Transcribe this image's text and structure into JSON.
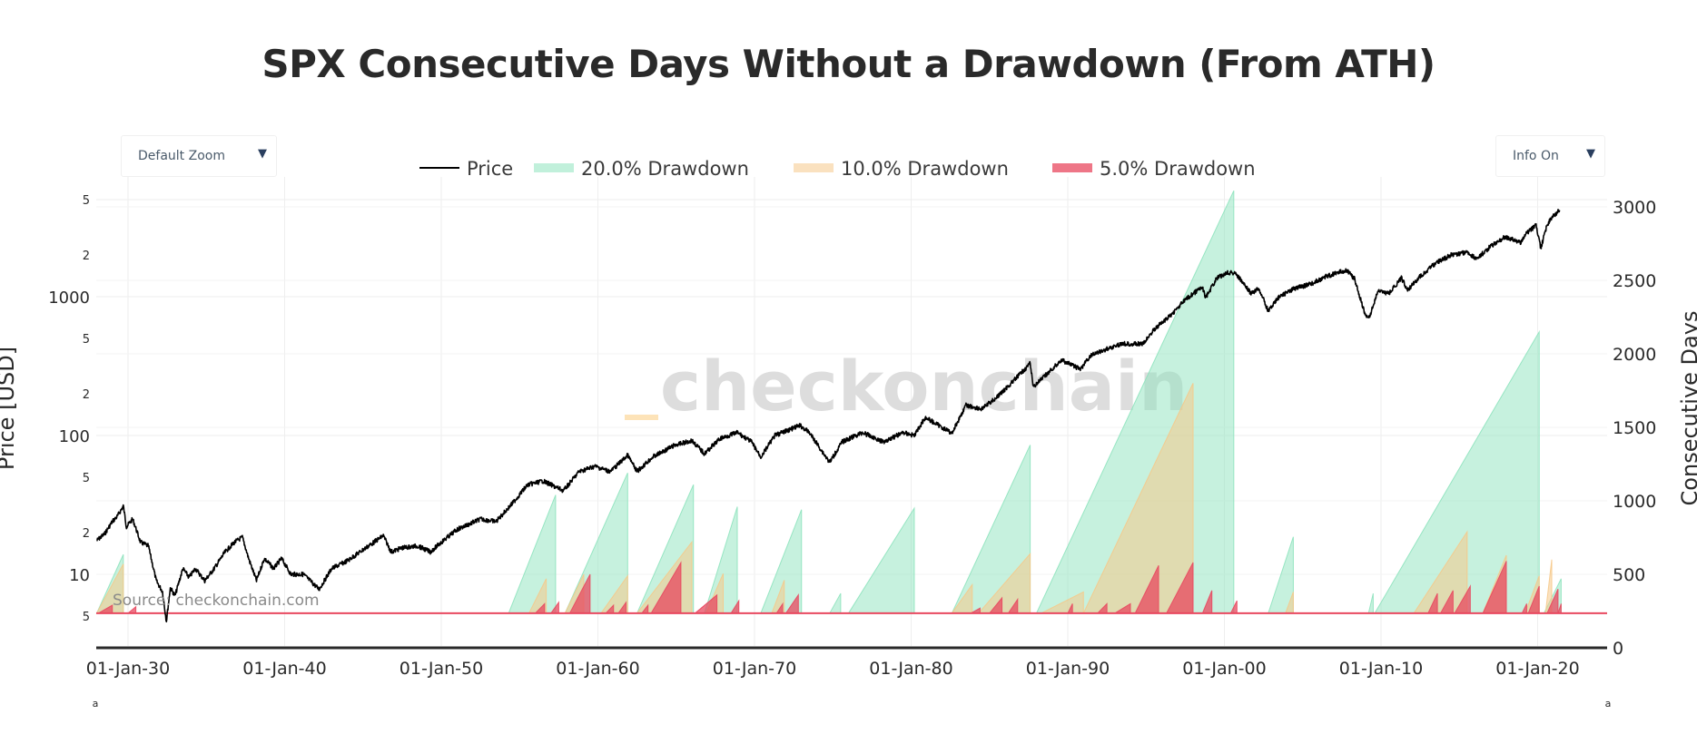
{
  "header": {
    "title": "SPX Consecutive Days Without a Drawdown (From ATH)"
  },
  "controls": {
    "zoom_dropdown": {
      "label": "Default Zoom",
      "icon": "triangle-down-icon"
    },
    "info_dropdown": {
      "label": "Info On",
      "icon": "triangle-down-icon"
    }
  },
  "watermark": "checkonchain",
  "source": "Source: checkonchain.com",
  "colors": {
    "price": "#000000",
    "dd20": "#8ee3be",
    "dd10": "#f6c98a",
    "dd5": "#e8485f",
    "grid": "#eeeeee",
    "axis": "#2a2a2a"
  },
  "chart_data": {
    "type": "area",
    "title": "SPX Consecutive Days Without a Drawdown (From ATH)",
    "xlabel": "",
    "ylabel": "Price [USD]",
    "y2label": "Consecutive Days",
    "x_range": [
      1928.0,
      2021.5
    ],
    "x_ticks": [
      {
        "year": 1930,
        "label": "01-Jan-30"
      },
      {
        "year": 1940,
        "label": "01-Jan-40"
      },
      {
        "year": 1950,
        "label": "01-Jan-50"
      },
      {
        "year": 1960,
        "label": "01-Jan-60"
      },
      {
        "year": 1970,
        "label": "01-Jan-70"
      },
      {
        "year": 1980,
        "label": "01-Jan-80"
      },
      {
        "year": 1990,
        "label": "01-Jan-90"
      },
      {
        "year": 2000,
        "label": "01-Jan-00"
      },
      {
        "year": 2010,
        "label": "01-Jan-10"
      },
      {
        "year": 2020,
        "label": "01-Jan-20"
      }
    ],
    "x_minor_labels": [
      "a",
      "a"
    ],
    "y_axis": {
      "scale": "log",
      "range": [
        4.4,
        6000
      ],
      "ticks": [
        {
          "value": 5,
          "label": "5"
        },
        {
          "value": 10,
          "label": "10"
        },
        {
          "value": 20,
          "label": "2"
        },
        {
          "value": 50,
          "label": "5"
        },
        {
          "value": 100,
          "label": "100"
        },
        {
          "value": 200,
          "label": "2"
        },
        {
          "value": 500,
          "label": "5"
        },
        {
          "value": 1000,
          "label": "1000"
        },
        {
          "value": 2000,
          "label": "2"
        },
        {
          "value": 5000,
          "label": "5"
        }
      ]
    },
    "y2_axis": {
      "scale": "linear",
      "range": [
        0,
        3200
      ],
      "ticks": [
        {
          "value": 0,
          "label": "0"
        },
        {
          "value": 500,
          "label": "500"
        },
        {
          "value": 1000,
          "label": "1000"
        },
        {
          "value": 1500,
          "label": "1500"
        },
        {
          "value": 2000,
          "label": "2000"
        },
        {
          "value": 2500,
          "label": "2500"
        },
        {
          "value": 3000,
          "label": "3000"
        }
      ]
    },
    "grid": true,
    "legend": {
      "placement": "top-center",
      "entries": [
        {
          "key": "price",
          "label": "Price"
        },
        {
          "key": "dd20",
          "label": "20.0% Drawdown"
        },
        {
          "key": "dd10",
          "label": "10.0% Drawdown"
        },
        {
          "key": "dd5",
          "label": "5.0% Drawdown"
        }
      ]
    },
    "series": [
      {
        "name": "Price",
        "key": "price",
        "axis": "y",
        "type": "line",
        "points": [
          [
            1928.0,
            17.5
          ],
          [
            1928.5,
            19.5
          ],
          [
            1929.0,
            24
          ],
          [
            1929.3,
            26
          ],
          [
            1929.7,
            31
          ],
          [
            1929.9,
            22
          ],
          [
            1930.3,
            25
          ],
          [
            1930.8,
            17
          ],
          [
            1931.3,
            16
          ],
          [
            1931.8,
            9
          ],
          [
            1932.2,
            7.5
          ],
          [
            1932.45,
            4.6
          ],
          [
            1932.7,
            8
          ],
          [
            1933.0,
            7
          ],
          [
            1933.5,
            11
          ],
          [
            1933.9,
            9.5
          ],
          [
            1934.3,
            11
          ],
          [
            1934.9,
            9
          ],
          [
            1935.5,
            11
          ],
          [
            1936.2,
            14.5
          ],
          [
            1936.8,
            17
          ],
          [
            1937.3,
            18.5
          ],
          [
            1937.7,
            13
          ],
          [
            1938.2,
            9
          ],
          [
            1938.7,
            13
          ],
          [
            1939.3,
            11
          ],
          [
            1939.8,
            13
          ],
          [
            1940.4,
            10
          ],
          [
            1941.2,
            10
          ],
          [
            1942.2,
            7.8
          ],
          [
            1943.0,
            11
          ],
          [
            1944.0,
            12.5
          ],
          [
            1945.0,
            15
          ],
          [
            1946.3,
            19
          ],
          [
            1946.8,
            14.5
          ],
          [
            1947.5,
            15.5
          ],
          [
            1948.5,
            16
          ],
          [
            1949.3,
            14.5
          ],
          [
            1950.0,
            17
          ],
          [
            1951.0,
            21
          ],
          [
            1952.5,
            25
          ],
          [
            1953.5,
            24
          ],
          [
            1954.5,
            32
          ],
          [
            1955.5,
            44
          ],
          [
            1956.5,
            47
          ],
          [
            1957.8,
            40
          ],
          [
            1958.8,
            55
          ],
          [
            1959.8,
            60
          ],
          [
            1960.8,
            55
          ],
          [
            1961.9,
            72
          ],
          [
            1962.5,
            55
          ],
          [
            1963.5,
            70
          ],
          [
            1964.9,
            85
          ],
          [
            1966.0,
            92
          ],
          [
            1966.8,
            74
          ],
          [
            1967.8,
            95
          ],
          [
            1968.9,
            105
          ],
          [
            1969.8,
            90
          ],
          [
            1970.4,
            70
          ],
          [
            1971.3,
            100
          ],
          [
            1972.9,
            118
          ],
          [
            1973.5,
            105
          ],
          [
            1974.8,
            64
          ],
          [
            1975.6,
            90
          ],
          [
            1976.9,
            105
          ],
          [
            1978.2,
            90
          ],
          [
            1979.5,
            105
          ],
          [
            1980.2,
            100
          ],
          [
            1980.9,
            135
          ],
          [
            1982.6,
            104
          ],
          [
            1983.5,
            165
          ],
          [
            1984.5,
            155
          ],
          [
            1985.5,
            190
          ],
          [
            1986.5,
            245
          ],
          [
            1987.6,
            330
          ],
          [
            1987.8,
            225
          ],
          [
            1988.5,
            265
          ],
          [
            1989.6,
            350
          ],
          [
            1990.8,
            300
          ],
          [
            1991.5,
            380
          ],
          [
            1992.5,
            420
          ],
          [
            1993.5,
            460
          ],
          [
            1994.8,
            455
          ],
          [
            1995.5,
            580
          ],
          [
            1996.5,
            720
          ],
          [
            1997.5,
            950
          ],
          [
            1998.6,
            1180
          ],
          [
            1998.8,
            980
          ],
          [
            1999.5,
            1350
          ],
          [
            2000.2,
            1500
          ],
          [
            2000.7,
            1480
          ],
          [
            2001.7,
            1050
          ],
          [
            2002.2,
            1150
          ],
          [
            2002.8,
            790
          ],
          [
            2003.5,
            1000
          ],
          [
            2004.5,
            1150
          ],
          [
            2005.5,
            1230
          ],
          [
            2006.5,
            1400
          ],
          [
            2007.8,
            1560
          ],
          [
            2008.3,
            1350
          ],
          [
            2008.9,
            800
          ],
          [
            2009.2,
            680
          ],
          [
            2009.8,
            1100
          ],
          [
            2010.5,
            1050
          ],
          [
            2011.3,
            1360
          ],
          [
            2011.7,
            1120
          ],
          [
            2012.5,
            1400
          ],
          [
            2013.5,
            1750
          ],
          [
            2014.5,
            2000
          ],
          [
            2015.5,
            2100
          ],
          [
            2016.1,
            1870
          ],
          [
            2016.9,
            2250
          ],
          [
            2017.9,
            2700
          ],
          [
            2018.9,
            2450
          ],
          [
            2019.2,
            2800
          ],
          [
            2019.9,
            3250
          ],
          [
            2020.2,
            2230
          ],
          [
            2020.6,
            3300
          ],
          [
            2021.0,
            3800
          ],
          [
            2021.4,
            4200
          ]
        ]
      },
      {
        "name": "20.0% Drawdown",
        "key": "dd20",
        "axis": "y2",
        "type": "sawtooth",
        "floor": 235,
        "runs": [
          [
            1928.0,
            1929.7,
            635
          ],
          [
            1954.3,
            1957.3,
            1040
          ],
          [
            1957.9,
            1961.9,
            1190
          ],
          [
            1962.5,
            1966.1,
            1110
          ],
          [
            1966.8,
            1968.9,
            960
          ],
          [
            1970.4,
            1973.0,
            940
          ],
          [
            1974.8,
            1975.5,
            370
          ],
          [
            1976.0,
            1980.2,
            950
          ],
          [
            1982.6,
            1987.6,
            1380
          ],
          [
            1988.0,
            2000.6,
            3110
          ],
          [
            2002.8,
            2004.4,
            755
          ],
          [
            2009.2,
            2009.5,
            370
          ],
          [
            2009.6,
            2020.1,
            2150
          ],
          [
            2020.4,
            2021.5,
            470
          ]
        ]
      },
      {
        "name": "10.0% Drawdown",
        "key": "dd10",
        "axis": "y2",
        "type": "sawtooth",
        "floor": 235,
        "runs": [
          [
            1928.0,
            1929.7,
            570
          ],
          [
            1955.6,
            1956.7,
            470
          ],
          [
            1957.9,
            1959.1,
            500
          ],
          [
            1960.2,
            1961.9,
            490
          ],
          [
            1962.5,
            1966.0,
            720
          ],
          [
            1966.9,
            1968.0,
            505
          ],
          [
            1971.1,
            1971.9,
            460
          ],
          [
            1982.6,
            1983.9,
            430
          ],
          [
            1984.3,
            1987.6,
            640
          ],
          [
            1988.3,
            1991.0,
            380
          ],
          [
            1991.0,
            1998.0,
            1800
          ],
          [
            2003.9,
            2004.4,
            380
          ],
          [
            2012.1,
            2015.5,
            790
          ],
          [
            2016.5,
            2018.0,
            630
          ],
          [
            2019.2,
            2020.1,
            490
          ],
          [
            2020.5,
            2020.9,
            600
          ]
        ]
      },
      {
        "name": "5.0% Drawdown",
        "key": "dd5",
        "axis": "y2",
        "type": "sawtooth",
        "floor": 235,
        "runs": [
          [
            1928.1,
            1929.0,
            290
          ],
          [
            1930.0,
            1930.5,
            280
          ],
          [
            1956.0,
            1956.6,
            300
          ],
          [
            1957.0,
            1957.5,
            310
          ],
          [
            1958.2,
            1959.5,
            500
          ],
          [
            1960.5,
            1961.0,
            290
          ],
          [
            1961.3,
            1961.8,
            310
          ],
          [
            1962.8,
            1963.2,
            290
          ],
          [
            1963.4,
            1965.3,
            580
          ],
          [
            1966.2,
            1967.6,
            360
          ],
          [
            1968.5,
            1969.0,
            320
          ],
          [
            1971.4,
            1971.8,
            300
          ],
          [
            1972.0,
            1972.8,
            360
          ],
          [
            1983.8,
            1984.4,
            270
          ],
          [
            1985.0,
            1985.8,
            340
          ],
          [
            1986.2,
            1986.8,
            330
          ],
          [
            1990.0,
            1990.3,
            300
          ],
          [
            1991.9,
            1992.5,
            300
          ],
          [
            1993.0,
            1994.0,
            300
          ],
          [
            1994.3,
            1995.8,
            560
          ],
          [
            1996.3,
            1998.0,
            580
          ],
          [
            1998.6,
            1999.2,
            390
          ],
          [
            2000.4,
            2000.8,
            320
          ],
          [
            2013.0,
            2013.6,
            370
          ],
          [
            2013.8,
            2014.6,
            390
          ],
          [
            2014.7,
            2015.7,
            420
          ],
          [
            2016.5,
            2018.0,
            590
          ],
          [
            2019.0,
            2019.3,
            300
          ],
          [
            2019.4,
            2020.1,
            420
          ],
          [
            2020.6,
            2021.3,
            400
          ],
          [
            2021.3,
            2021.5,
            300
          ]
        ]
      }
    ]
  }
}
